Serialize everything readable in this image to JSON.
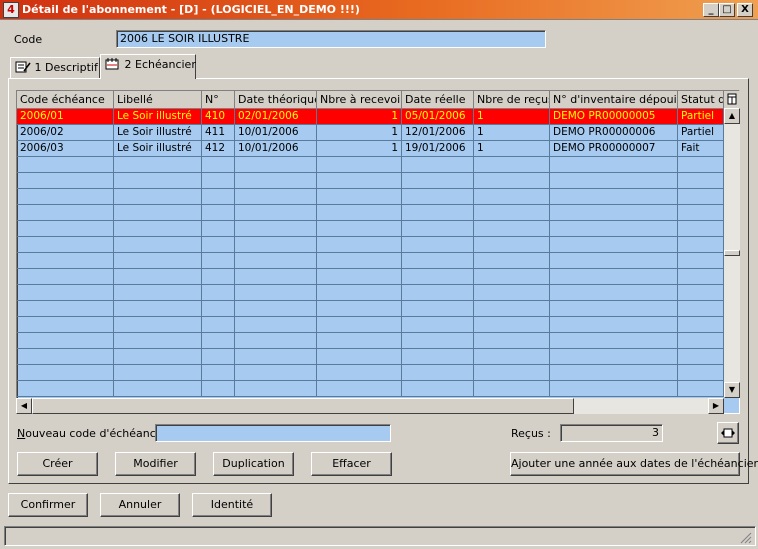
{
  "window": {
    "title": "Détail de l'abonnement - [D] - (LOGICIEL_EN_DEMO !!!)",
    "buttons": [
      "_",
      "□",
      "X"
    ]
  },
  "code": {
    "label": "Code",
    "value": "2006 LE SOIR ILLUSTRE"
  },
  "tabs": [
    {
      "label": "1 Descriptif",
      "icon": "form-edit-icon"
    },
    {
      "label": "2 Echéancier",
      "icon": "calendar-icon",
      "active": true
    }
  ],
  "grid": {
    "columns": [
      "Code échéance",
      "Libellé",
      "N°",
      "Date théorique",
      "Nbre à recevoir",
      "Date réelle",
      "Nbre de reçus",
      "N° d'inventaire dépouillé",
      "Statut de"
    ],
    "rows": [
      [
        "2006/01",
        "Le Soir illustré",
        "410",
        "02/01/2006",
        "1",
        "05/01/2006",
        "1",
        "DEMO PR00000005",
        "Partiel"
      ],
      [
        "2006/02",
        "Le Soir illustré",
        "411",
        "10/01/2006",
        "1",
        "12/01/2006",
        "1",
        "DEMO PR00000006",
        "Partiel"
      ],
      [
        "2006/03",
        "Le Soir illustré",
        "412",
        "10/01/2006",
        "1",
        "19/01/2006",
        "1",
        "DEMO PR00000007",
        "Fait"
      ]
    ],
    "selected_row": 0,
    "colors": {
      "background": "#a6caf0",
      "selected_bg": "#ff0000",
      "selected_text": "#ffff00"
    }
  },
  "nouveau": {
    "label": "Nouveau code d'échéance",
    "value": ""
  },
  "recus": {
    "label": "Reçus :",
    "value": "3"
  },
  "actions": {
    "creer": "Créer",
    "modifier": "Modifier",
    "duplication": "Duplication",
    "effacer": "Effacer",
    "ajouter": "Ajouter une année aux dates de l'échéancier"
  },
  "footer": {
    "confirmer": "Confirmer",
    "annuler": "Annuler",
    "identite": "Identité"
  }
}
